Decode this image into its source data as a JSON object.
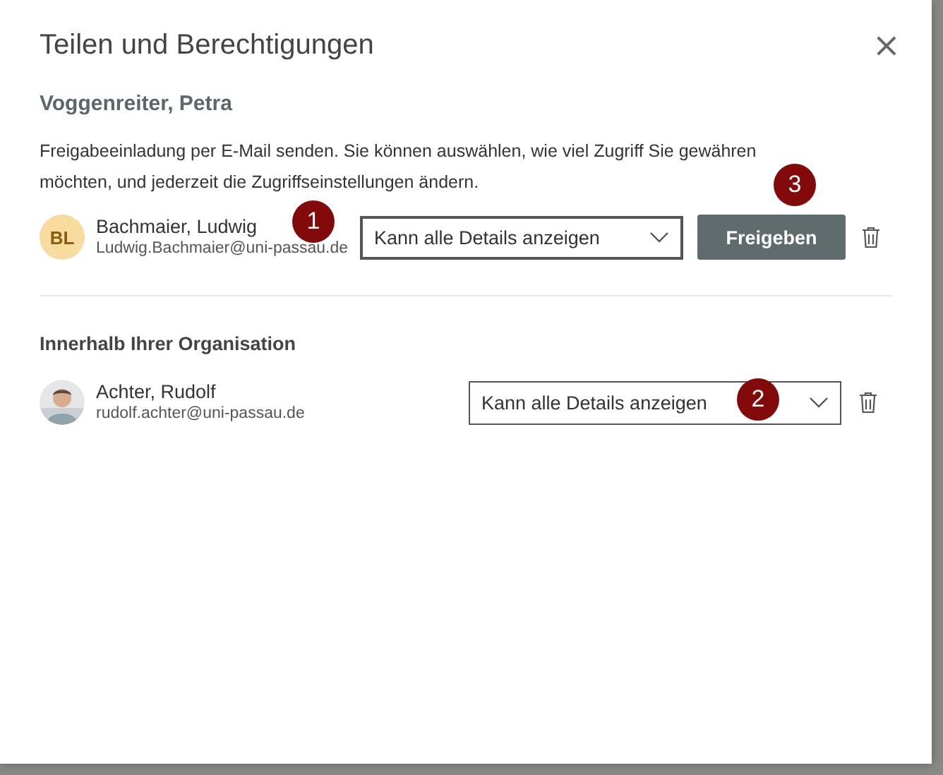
{
  "dialog": {
    "title": "Teilen und Berechtigungen",
    "close": "×"
  },
  "owner": "Voggenreiter, Petra",
  "description": "Freigabeeinladung per E-Mail senden. Sie können auswählen, wie viel Zugriff Sie gewähren möchten, und jederzeit die Zugriffseinstellungen ändern.",
  "invite": {
    "avatar": {
      "kind": "initials",
      "text": "BL"
    },
    "name": "Bachmaier, Ludwig",
    "email": "Ludwig.Bachmaier@uni-passau.de",
    "marker": "1",
    "permission": "Kann alle Details anzeigen",
    "button": {
      "label": "Freigeben",
      "marker": "3"
    }
  },
  "section": {
    "heading": "Innerhalb Ihrer Organisation",
    "members": [
      {
        "name": "Achter, Rudolf",
        "email": "rudolf.achter@uni-passau.de",
        "permission": "Kann alle Details anzeigen",
        "marker": "2"
      }
    ]
  }
}
